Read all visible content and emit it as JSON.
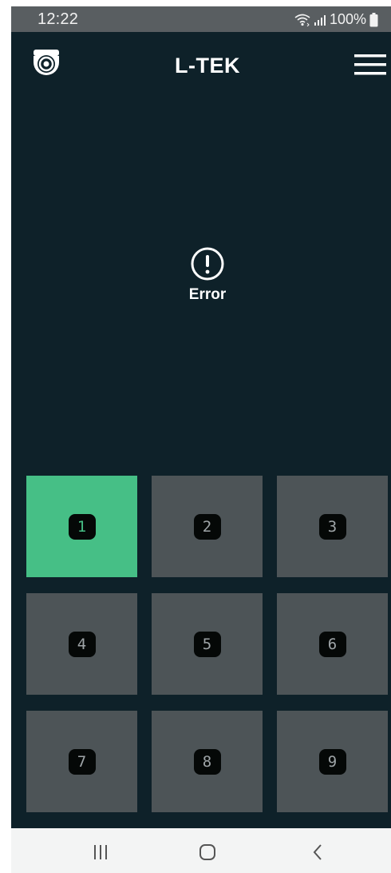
{
  "status_bar": {
    "time": "12:22",
    "battery": "100%",
    "icons": [
      "wifi-icon",
      "signal-icon",
      "battery-icon"
    ]
  },
  "header": {
    "brand": "L-TEK",
    "left_icon": "security-camera-icon",
    "right_icon": "hamburger-menu-icon"
  },
  "main": {
    "error_icon": "exclamation-circle-icon",
    "error_text": "Error"
  },
  "channels": [
    {
      "label": "1",
      "active": true
    },
    {
      "label": "2",
      "active": false
    },
    {
      "label": "3",
      "active": false
    },
    {
      "label": "4",
      "active": false
    },
    {
      "label": "5",
      "active": false
    },
    {
      "label": "6",
      "active": false
    },
    {
      "label": "7",
      "active": false
    },
    {
      "label": "8",
      "active": false
    },
    {
      "label": "9",
      "active": false
    }
  ],
  "nav": {
    "recent": "recent-apps-icon",
    "home": "home-icon",
    "back": "back-icon"
  },
  "colors": {
    "background": "#0e2129",
    "active_tile": "#46bf86",
    "tile": "#4d5457",
    "status_bar": "#595e61"
  }
}
